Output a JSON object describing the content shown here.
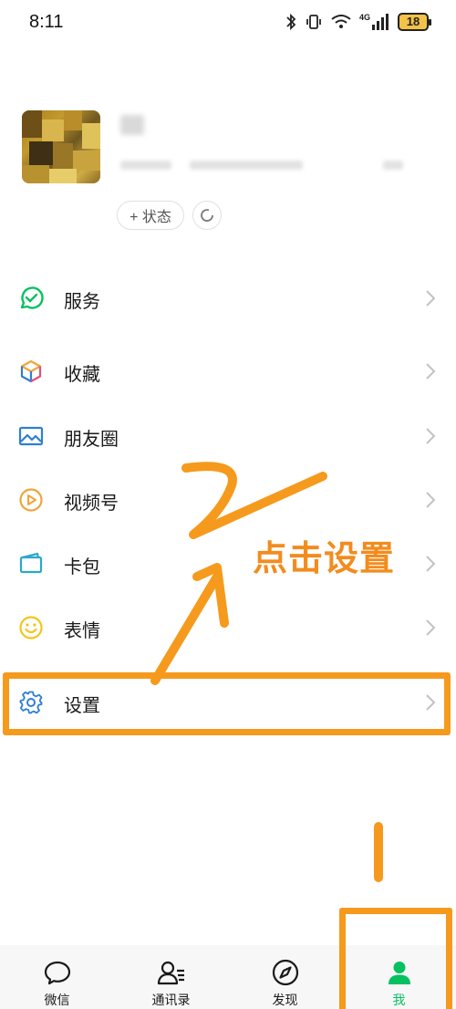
{
  "status_bar": {
    "time": "8:11",
    "network_label": "4G",
    "battery_level": "18",
    "icons": [
      "bluetooth-icon",
      "vibrate-icon",
      "wifi-icon",
      "signal-icon",
      "battery-icon"
    ]
  },
  "profile": {
    "status_button_label": "+ 状态",
    "refresh_icon": "refresh-icon"
  },
  "menu": {
    "items": [
      {
        "label": "服务",
        "icon": "service-icon",
        "color": "#07c160"
      },
      {
        "label": "收藏",
        "icon": "favorites-cube-icon",
        "color": "#f0a43a"
      },
      {
        "label": "朋友圈",
        "icon": "moments-image-icon",
        "color": "#2f7fd1"
      },
      {
        "label": "视频号",
        "icon": "channels-play-icon",
        "color": "#f0a43a"
      },
      {
        "label": "卡包",
        "icon": "card-wallet-icon",
        "color": "#2aa9c9"
      },
      {
        "label": "表情",
        "icon": "emoji-smile-icon",
        "color": "#f5c518"
      },
      {
        "label": "设置",
        "icon": "gear-icon",
        "color": "#2f7fd1"
      }
    ]
  },
  "annotation": {
    "callout_text": "点击设置",
    "color": "#f59a1d"
  },
  "tab_bar": {
    "tabs": [
      {
        "label": "微信",
        "icon": "chat-bubble-icon",
        "active": false
      },
      {
        "label": "通讯录",
        "icon": "contacts-icon",
        "active": false
      },
      {
        "label": "发现",
        "icon": "compass-icon",
        "active": false
      },
      {
        "label": "我",
        "icon": "person-icon",
        "active": true
      }
    ],
    "active_color": "#07c160"
  }
}
